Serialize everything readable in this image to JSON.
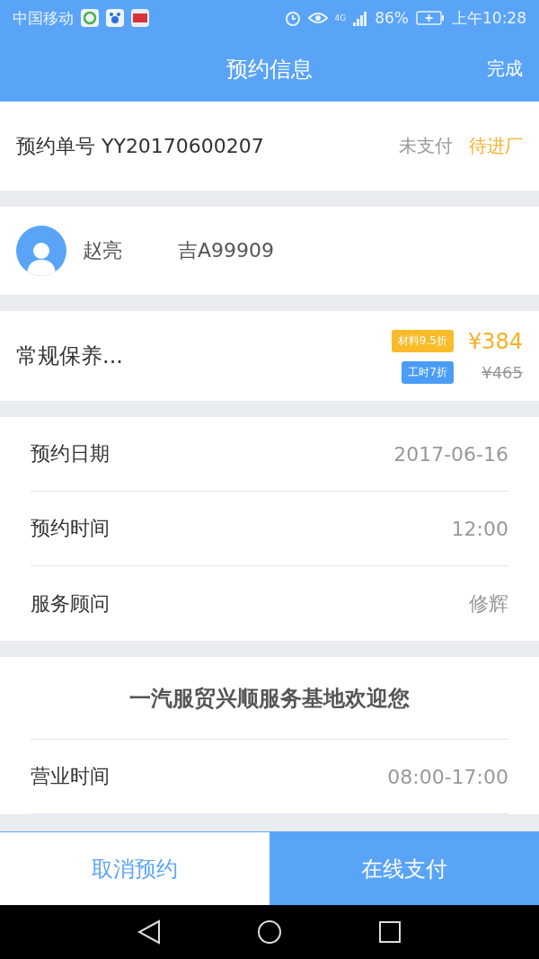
{
  "status_bar": {
    "carrier": "中国移动",
    "network": "4G",
    "battery": "86%",
    "time": "上午10:28"
  },
  "header": {
    "title": "预约信息",
    "action": "完成"
  },
  "order": {
    "label": "预约单号",
    "number": "YY20170600207",
    "payment_status": "未支付",
    "progress_status": "待进厂"
  },
  "customer": {
    "name": "赵亮",
    "plate": "吉A99909"
  },
  "service": {
    "name": "常规保养...",
    "price": "¥384",
    "original_price": "¥465",
    "tags": [
      {
        "label": "材料9.5折",
        "color": "#f9bb2a"
      },
      {
        "label": "工时7折",
        "color": "#4a9cf7"
      }
    ]
  },
  "details": [
    {
      "label": "预约日期",
      "value": "2017-06-16"
    },
    {
      "label": "预约时间",
      "value": "12:00"
    },
    {
      "label": "服务顾问",
      "value": "修辉"
    }
  ],
  "shop": {
    "title": "一汽服贸兴顺服务基地欢迎您",
    "rows": [
      {
        "label": "营业时间",
        "value": "08:00-17:00"
      }
    ]
  },
  "buttons": [
    {
      "label": "取消预约",
      "kind": "secondary"
    },
    {
      "label": "在线支付",
      "kind": "primary"
    }
  ]
}
